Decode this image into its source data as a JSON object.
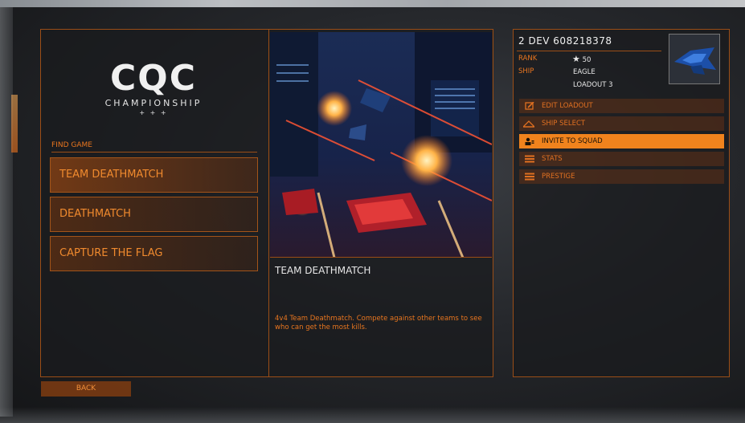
{
  "logo": {
    "letters": "CQC",
    "subtitle": "CHAMPIONSHIP",
    "stars": "+ + +"
  },
  "find_game": {
    "label": "FIND GAME",
    "modes": [
      {
        "label": "TEAM DEATHMATCH",
        "active": true
      },
      {
        "label": "DEATHMATCH",
        "active": false
      },
      {
        "label": "CAPTURE THE FLAG",
        "active": false
      }
    ]
  },
  "description": {
    "title": "TEAM DEATHMATCH",
    "text": "4v4 Team Deathmatch. Compete against other teams to see who can get the most kills."
  },
  "back_label": "BACK",
  "commander": {
    "name": "2 DEV 608218378",
    "rank_label": "RANK",
    "rank_value": "50",
    "ship_label": "SHIP",
    "ship_value": "EAGLE",
    "loadout": "LOADOUT 3"
  },
  "menu": [
    {
      "label": "EDIT LOADOUT",
      "icon": "edit-icon",
      "highlight": false
    },
    {
      "label": "SHIP SELECT",
      "icon": "ship-icon",
      "highlight": false
    },
    {
      "label": "INVITE TO SQUAD",
      "icon": "users-icon",
      "highlight": true
    },
    {
      "label": "STATS",
      "icon": "list-icon",
      "highlight": false
    },
    {
      "label": "PRESTIGE",
      "icon": "list-icon",
      "highlight": false
    }
  ],
  "colors": {
    "accent": "#e9761f",
    "highlight": "#f0831d",
    "border": "#9b4e17"
  }
}
